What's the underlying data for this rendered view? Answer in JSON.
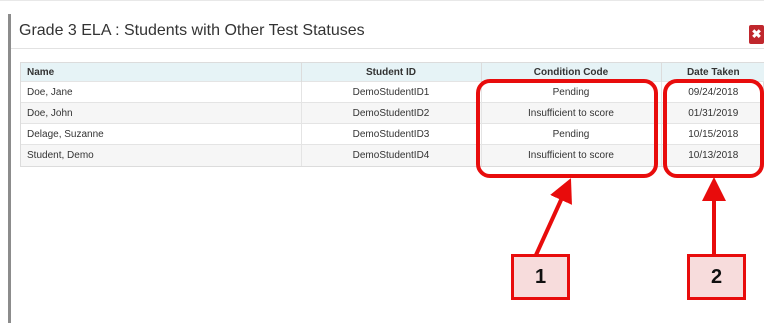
{
  "dialog": {
    "title": "Grade 3 ELA : Students with Other Test Statuses",
    "close_icon": "✖"
  },
  "table": {
    "columns": [
      "Name",
      "Student ID",
      "Condition Code",
      "Date Taken"
    ],
    "rows": [
      [
        "Doe, Jane",
        "DemoStudentID1",
        "Pending",
        "09/24/2018"
      ],
      [
        "Doe, John",
        "DemoStudentID2",
        "Insufficient to score",
        "01/31/2019"
      ],
      [
        "Delage, Suzanne",
        "DemoStudentID3",
        "Pending",
        "10/15/2018"
      ],
      [
        "Student, Demo",
        "DemoStudentID4",
        "Insufficient to score",
        "10/13/2018"
      ]
    ]
  },
  "annotations": {
    "callout_1": "1",
    "callout_2": "2",
    "color": "#e80c0c"
  },
  "colors": {
    "header_row_bg": "#e6f3f6",
    "close_button_bg": "#c0272d"
  }
}
